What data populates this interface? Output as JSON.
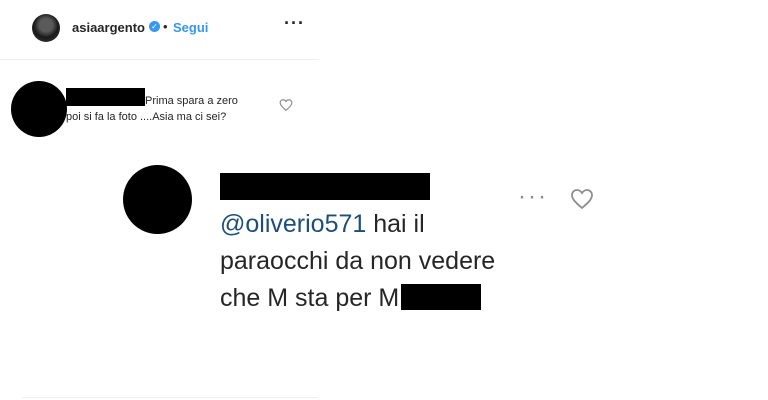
{
  "post": {
    "username": "asiaargento",
    "separator": "•",
    "follow_label": "Segui",
    "more_label": "···"
  },
  "comment": {
    "line1": "Prima spara a zero",
    "line2": "poi si fa la foto ....Asia ma ci sei?"
  },
  "reply": {
    "mention": "@oliverio571",
    "text_line1": " hai il",
    "text_line2": "paraocchi da non vedere",
    "text_line3": "che M sta per M",
    "more_label": "···"
  }
}
